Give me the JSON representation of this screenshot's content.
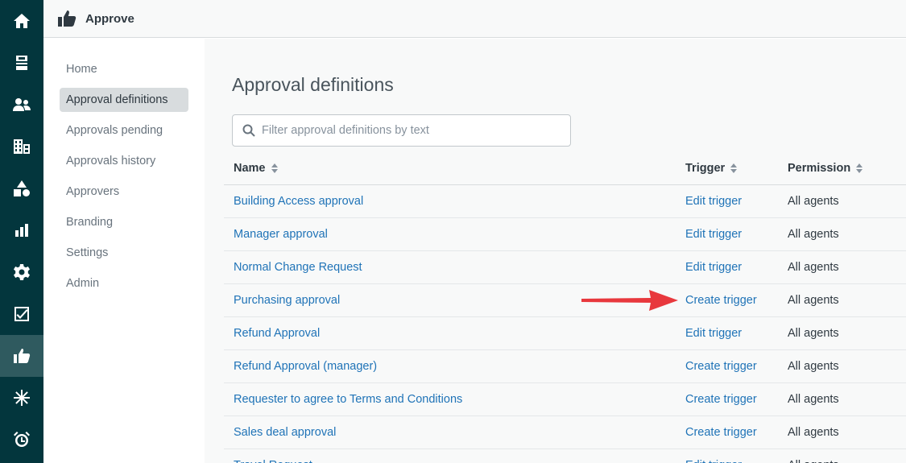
{
  "rail": {
    "items": [
      {
        "icon": "home-icon",
        "active": false
      },
      {
        "icon": "views-icon",
        "active": false
      },
      {
        "icon": "customers-icon",
        "active": false
      },
      {
        "icon": "organizations-icon",
        "active": false
      },
      {
        "icon": "shapes-icon",
        "active": false
      },
      {
        "icon": "reporting-icon",
        "active": false
      },
      {
        "icon": "admin-gear-icon",
        "active": false
      },
      {
        "icon": "checkbox-icon",
        "active": false
      },
      {
        "icon": "approve-thumb-icon",
        "active": true
      },
      {
        "icon": "asterisk-icon",
        "active": false
      },
      {
        "icon": "alarm-clock-icon",
        "active": false
      }
    ]
  },
  "header": {
    "logo_icon": "thumbs-up-icon",
    "title": "Approve"
  },
  "subnav": {
    "items": [
      {
        "label": "Home",
        "active": false
      },
      {
        "label": "Approval definitions",
        "active": true
      },
      {
        "label": "Approvals pending",
        "active": false
      },
      {
        "label": "Approvals history",
        "active": false
      },
      {
        "label": "Approvers",
        "active": false
      },
      {
        "label": "Branding",
        "active": false
      },
      {
        "label": "Settings",
        "active": false
      },
      {
        "label": "Admin",
        "active": false
      }
    ]
  },
  "main": {
    "title": "Approval definitions",
    "search": {
      "placeholder": "Filter approval definitions by text",
      "value": ""
    },
    "table": {
      "columns": [
        "Name",
        "Trigger",
        "Permission"
      ],
      "rows": [
        {
          "name": "Building Access approval",
          "trigger": "Edit trigger",
          "permission": "All agents"
        },
        {
          "name": "Manager approval",
          "trigger": "Edit trigger",
          "permission": "All agents"
        },
        {
          "name": "Normal Change Request",
          "trigger": "Edit trigger",
          "permission": "All agents"
        },
        {
          "name": "Purchasing approval",
          "trigger": "Create trigger",
          "permission": "All agents"
        },
        {
          "name": "Refund Approval",
          "trigger": "Edit trigger",
          "permission": "All agents"
        },
        {
          "name": "Refund Approval (manager)",
          "trigger": "Create trigger",
          "permission": "All agents"
        },
        {
          "name": "Requester to agree to Terms and Conditions",
          "trigger": "Create trigger",
          "permission": "All agents"
        },
        {
          "name": "Sales deal approval",
          "trigger": "Create trigger",
          "permission": "All agents"
        },
        {
          "name": "Travel Request",
          "trigger": "Edit trigger",
          "permission": "All agents"
        }
      ]
    },
    "annotation": {
      "icon": "red-arrow-annotation",
      "color": "#e8383d"
    }
  },
  "colors": {
    "rail_bg": "#03363d",
    "link": "#1f73b7",
    "text": "#2f3941"
  }
}
